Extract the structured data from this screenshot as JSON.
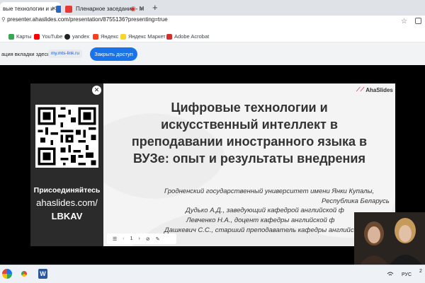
{
  "browser": {
    "tabs": [
      {
        "title": "вые технологии и и",
        "active": true,
        "favicon_color": "#2a64c5"
      },
      {
        "title": "Пленарное заседание - М",
        "active": false,
        "favicon_color": "#e53935"
      }
    ],
    "url": "presenter.ahaslides.com/presentation/8755136?presenting=true",
    "bookmarks": [
      "Карты",
      "YouTube",
      "yandex",
      "Яндекс",
      "Яндекс Маркет",
      "Adobe Acrobat"
    ],
    "share_bar": {
      "text": "ация вкладки здесь:",
      "chip": "my.mts-link.ru",
      "button": "Закрыть доступ"
    }
  },
  "presentation": {
    "logo": "AhaSlides",
    "join": {
      "title": "Присоединяйтесь",
      "site": "ahaslides.com/",
      "code": "LBKAV"
    },
    "slide": {
      "title_lines": [
        "Цифровые технологии и",
        "искусственный интеллект в",
        "преподавании иностранного языка в",
        "ВУЗе: опыт и результаты внедрения"
      ],
      "body_lines": [
        "Гродненский государственный университет имени Янки Купалы,",
        "Республика Беларусь",
        "Дудько А.Д., заведующий кафедрой английской ф",
        "Левченко Н.А., доцент кафедры английской ф",
        "Дашкевич С.С., старший преподаватель кафедры английской ф"
      ]
    },
    "controls": {
      "page": "1"
    }
  },
  "taskbar": {
    "lang": "РУС",
    "clock": "2"
  }
}
